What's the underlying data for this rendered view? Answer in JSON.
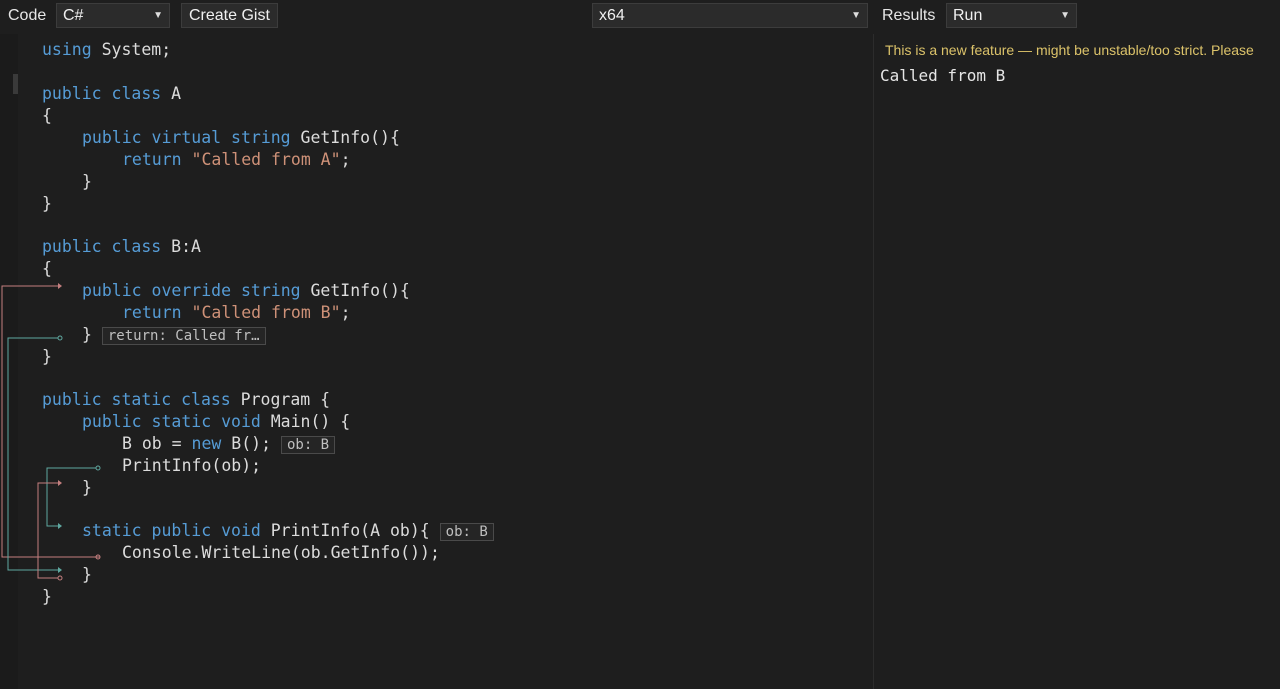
{
  "toolbar": {
    "code_label": "Code",
    "language": "C#",
    "create_gist": "Create Gist",
    "platform": "x64",
    "results_label": "Results",
    "mode": "Run"
  },
  "results": {
    "warning": "This is a new feature — might be unstable/too strict. Please",
    "output": "Called from B"
  },
  "code": {
    "l1_kw": "using",
    "l1_rest": " System;",
    "l3_kw": "public class",
    "l3_name": " A",
    "l4": "{",
    "l5_kw1": "public virtual",
    "l5_kw2": "string",
    "l5_rest": " GetInfo(){",
    "l6_kw": "return",
    "l6_str": "\"Called from A\"",
    "l6_end": ";",
    "l7": "}",
    "l8": "}",
    "l10_kw": "public class",
    "l10_name": " B:A",
    "l11": "{",
    "l12_kw1": "public override",
    "l12_kw2": "string",
    "l12_rest": " GetInfo(){",
    "l13_kw": "return",
    "l13_str": "\"Called from B\"",
    "l13_end": ";",
    "l14": "}",
    "l14_hint": "return: Called fr…",
    "l15": "}",
    "l17_kw": "public static class",
    "l17_name": " Program {",
    "l18_kw": "public static void",
    "l18_rest": " Main() {",
    "l19_a": "B ob = ",
    "l19_kw": "new",
    "l19_b": " B();",
    "l19_hint": "ob: B",
    "l20": "PrintInfo(ob);",
    "l21": "}",
    "l23_kw": "static public void",
    "l23_rest": " PrintInfo(A ob){",
    "l23_hint": "ob: B",
    "l24": "Console.WriteLine(ob.GetInfo());",
    "l25": "}",
    "l26": "}"
  },
  "colors": {
    "keyword": "#569cd6",
    "string": "#ce9178",
    "warning": "#dcc36a",
    "background": "#1e1e1e"
  }
}
